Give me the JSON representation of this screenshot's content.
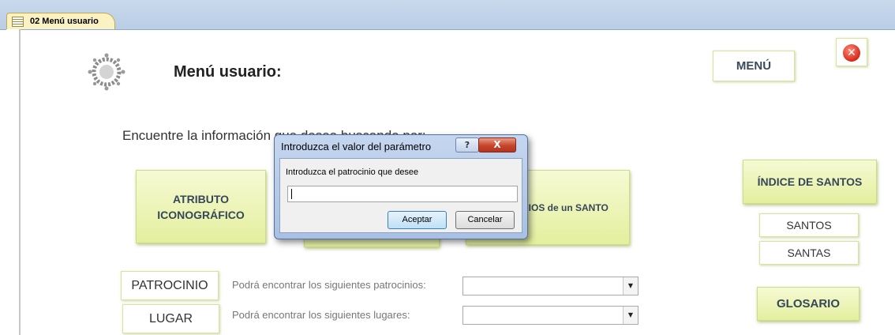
{
  "tab": {
    "label": "02 Menú usuario"
  },
  "header": {
    "title": "Menú usuario:",
    "menu_button": "MENÚ"
  },
  "subtitle": "Encuentre la información que desea buscando por:",
  "left_buttons": {
    "atributo_line1": "ATRIBUTO",
    "atributo_line2": "ICONOGRÁFICO",
    "patrocinios_santo": "NIOS de un  SANTO"
  },
  "right_panel": {
    "indice": "ÍNDICE DE SANTOS",
    "santos": "SANTOS",
    "santas": "SANTAS",
    "glosario": "GLOSARIO"
  },
  "filters": {
    "patrocinio_button": "PATROCINIO",
    "patrocinio_label": "Podrá encontrar los siguientes patrocinios:",
    "lugar_button": "LUGAR",
    "lugar_label": "Podrá encontrar los siguientes lugares:",
    "patrocinio_value": "",
    "lugar_value": ""
  },
  "dialog": {
    "title": "Introduzca el valor del parámetro",
    "help": "?",
    "close": "X",
    "prompt": "Introduzca el patrocinio que desee",
    "input_value": "",
    "ok": "Aceptar",
    "cancel": "Cancelar"
  },
  "colors": {
    "accent_green": "#e3ef9e",
    "tab_bg": "#fbf2c3",
    "ribbon": "#c9d9ec",
    "close_red": "#d52a1a"
  }
}
